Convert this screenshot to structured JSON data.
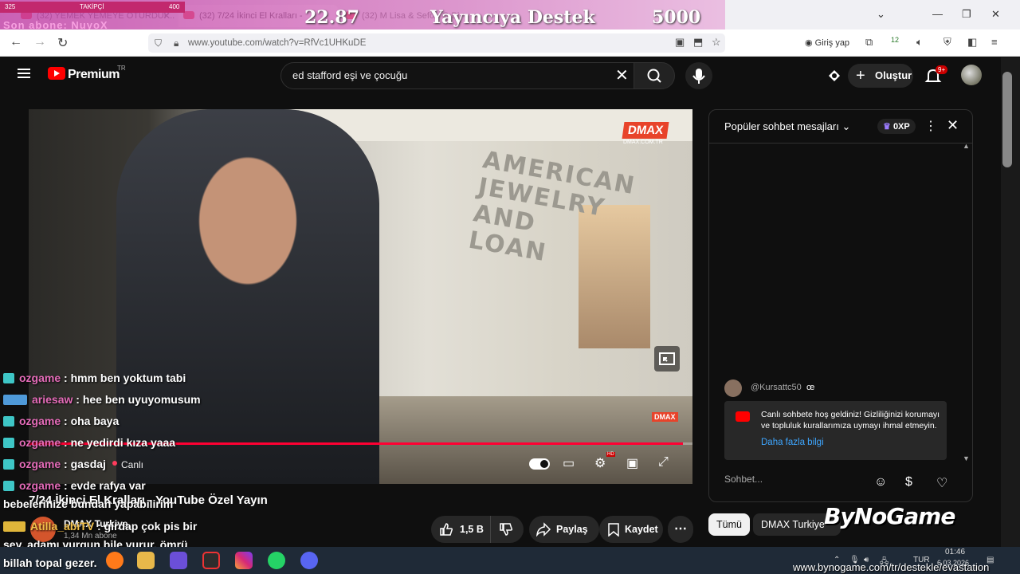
{
  "browser": {
    "tabs": [
      {
        "label": "(32) YEMEK YEMEYE OTURDUK...",
        "active": false
      },
      {
        "label": "(32) 7/24 İkinci El Kralları -",
        "active": true
      },
      {
        "label": "(32) M Lisa & Sefo - O Bi",
        "active": false
      }
    ],
    "url": "www.youtube.com/watch?v=RfVc1UHKuDE",
    "login_label": "Giriş yap",
    "extension_badge": "12"
  },
  "stream_overlay": {
    "follower_count": "325",
    "follower_label": "TAKİPÇİ",
    "follower_goal": "400",
    "last_sub": "Son abone: NuyoX",
    "donation_amount": "22.87",
    "donation_title": "Yayıncıya Destek",
    "donation_goal": "5000"
  },
  "youtube": {
    "brand": "Premium",
    "region": "TR",
    "search_query": "ed stafford eşi ve çocuğu",
    "create_label": "Oluştur",
    "notification_badge": "9+"
  },
  "video": {
    "progress": 0.985,
    "live_label": "Canlı",
    "title": "7/24 İkinci El Kralları - YouTube Özel Yayın",
    "channel": "DMAX Turkiye",
    "subscribers": "1,34 Mn abone",
    "like_count": "1,5 B",
    "share_label": "Paylaş",
    "save_label": "Kaydet",
    "watermark": "DMAX",
    "watermark_sub": "DMAX.COM.TR",
    "wall_text": "AMERICAN JEWELRY AND LOAN",
    "hd_badge": "HD"
  },
  "live_chat": {
    "header": "Popüler sohbet mesajları",
    "xp": "0XP",
    "message_author": "@Kursattc50",
    "message_text": "œ",
    "welcome_text": "Canlı sohbete hoş geldiniz! Gizliliğinizi korumayı ve topluluk kurallarımıza uymayı ihmal etmeyin.",
    "welcome_link": "Daha fazla bilgi",
    "input_placeholder": "Sohbet...",
    "chips": [
      "Tümü",
      "DMAX Turkiye a"
    ]
  },
  "stream_chat": [
    {
      "name": "ozgame",
      "text": ": hmm ben yoktum tabi"
    },
    {
      "name": "ariesaw",
      "text": ": hee ben uyuyomusum"
    },
    {
      "name": "ozgame",
      "text": ": oha baya"
    },
    {
      "name": "ozgame",
      "text": ": ne yedirdi kıza yaaa"
    },
    {
      "name": "ozgame",
      "text": ": gasdaj"
    },
    {
      "name": "ozgame",
      "text": ": evde rafya var"
    },
    {
      "name": "",
      "text": "bebelerinize bundan yapabilirim"
    },
    {
      "name": "Atilla_abiTV",
      "text": ": girdap çok pis bir"
    },
    {
      "name": "",
      "text": "şey. adamı vurgun bile vurur. ömrü"
    },
    {
      "name": "",
      "text": "billah topal gezer."
    }
  ],
  "branding": {
    "logo": "ByNoGame",
    "promo_url": "www.bynogame.com/tr/destekle/evastation"
  },
  "taskbar": {
    "language": "TUR",
    "time": "01:46",
    "date": "6.03.2026"
  }
}
